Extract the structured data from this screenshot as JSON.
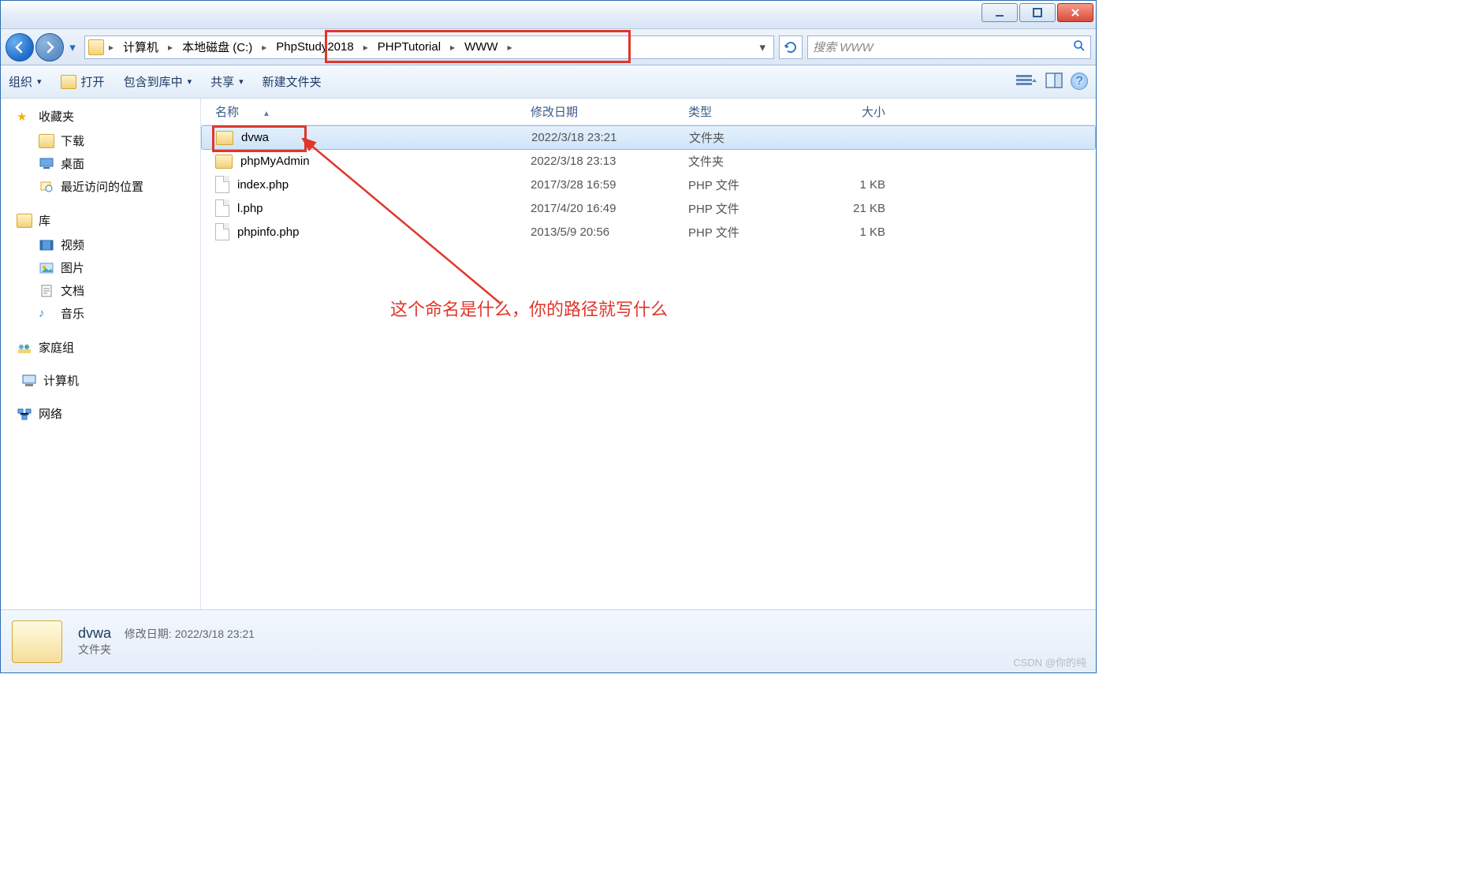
{
  "breadcrumb": {
    "items": [
      "计算机",
      "本地磁盘 (C:)",
      "PhpStudy2018",
      "PHPTutorial",
      "WWW"
    ]
  },
  "search": {
    "placeholder": "搜索 WWW"
  },
  "toolbar": {
    "organize": "组织",
    "open": "打开",
    "include": "包含到库中",
    "share": "共享",
    "newfolder": "新建文件夹"
  },
  "nav": {
    "favorites": "收藏夹",
    "downloads": "下载",
    "desktop": "桌面",
    "recent": "最近访问的位置",
    "libraries": "库",
    "videos": "视频",
    "pictures": "图片",
    "documents": "文档",
    "music": "音乐",
    "homegroup": "家庭组",
    "computer": "计算机",
    "network": "网络"
  },
  "columns": {
    "name": "名称",
    "date": "修改日期",
    "type": "类型",
    "size": "大小"
  },
  "files": [
    {
      "name": "dvwa",
      "date": "2022/3/18 23:21",
      "type": "文件夹",
      "size": "",
      "kind": "folder",
      "selected": true
    },
    {
      "name": "phpMyAdmin",
      "date": "2022/3/18 23:13",
      "type": "文件夹",
      "size": "",
      "kind": "folder",
      "selected": false
    },
    {
      "name": "index.php",
      "date": "2017/3/28 16:59",
      "type": "PHP 文件",
      "size": "1 KB",
      "kind": "file",
      "selected": false
    },
    {
      "name": "l.php",
      "date": "2017/4/20 16:49",
      "type": "PHP 文件",
      "size": "21 KB",
      "kind": "file",
      "selected": false
    },
    {
      "name": "phpinfo.php",
      "date": "2013/5/9 20:56",
      "type": "PHP 文件",
      "size": "1 KB",
      "kind": "file",
      "selected": false
    }
  ],
  "annotation": "这个命名是什么，你的路径就写什么",
  "details": {
    "name": "dvwa",
    "date_label": "修改日期:",
    "date": "2022/3/18 23:21",
    "type": "文件夹"
  },
  "watermark": "CSDN @你的纯"
}
